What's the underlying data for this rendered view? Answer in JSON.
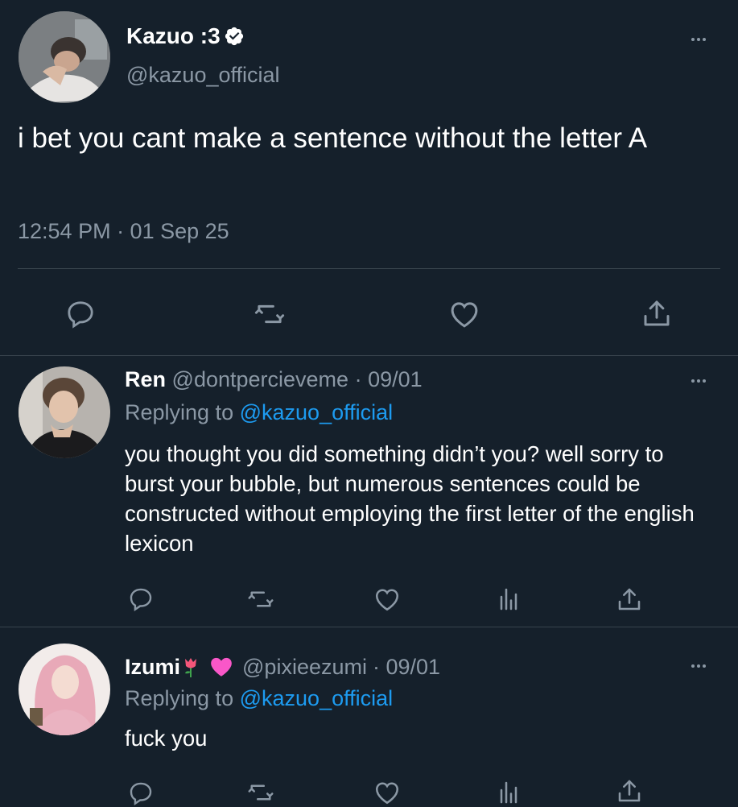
{
  "main_tweet": {
    "display_name": "Kazuo :3",
    "handle": "@kazuo_official",
    "text": "i bet you cant make a sentence without the letter A",
    "timestamp": "12:54 PM · 01 Sep 25",
    "verified": true,
    "icons": [
      "reply-icon",
      "retweet-icon",
      "like-icon",
      "share-icon"
    ]
  },
  "replies": [
    {
      "display_name": "Ren",
      "handle": "@dontpercieveme",
      "date": "· 09/01",
      "replying_prefix": "Replying to",
      "replying_to": "@kazuo_official",
      "text": "you thought you did something didn’t you? well sorry to burst your bubble, but numerous sentences could be constructed without employing the first letter of the english lexicon"
    },
    {
      "display_name": "Izumi",
      "handle": "@pixieezumi",
      "date": "· 09/01",
      "replying_prefix": "Replying to",
      "replying_to": "@kazuo_official",
      "text": "fuck you",
      "name_emojis": [
        "rose-icon",
        "pink-heart-icon"
      ]
    }
  ],
  "colors": {
    "background": "#15202b",
    "muted": "#8b98a5",
    "link": "#1d9bf0",
    "divider": "#38444d",
    "verified_badge": "#ffffff",
    "heart": "#f91880"
  }
}
